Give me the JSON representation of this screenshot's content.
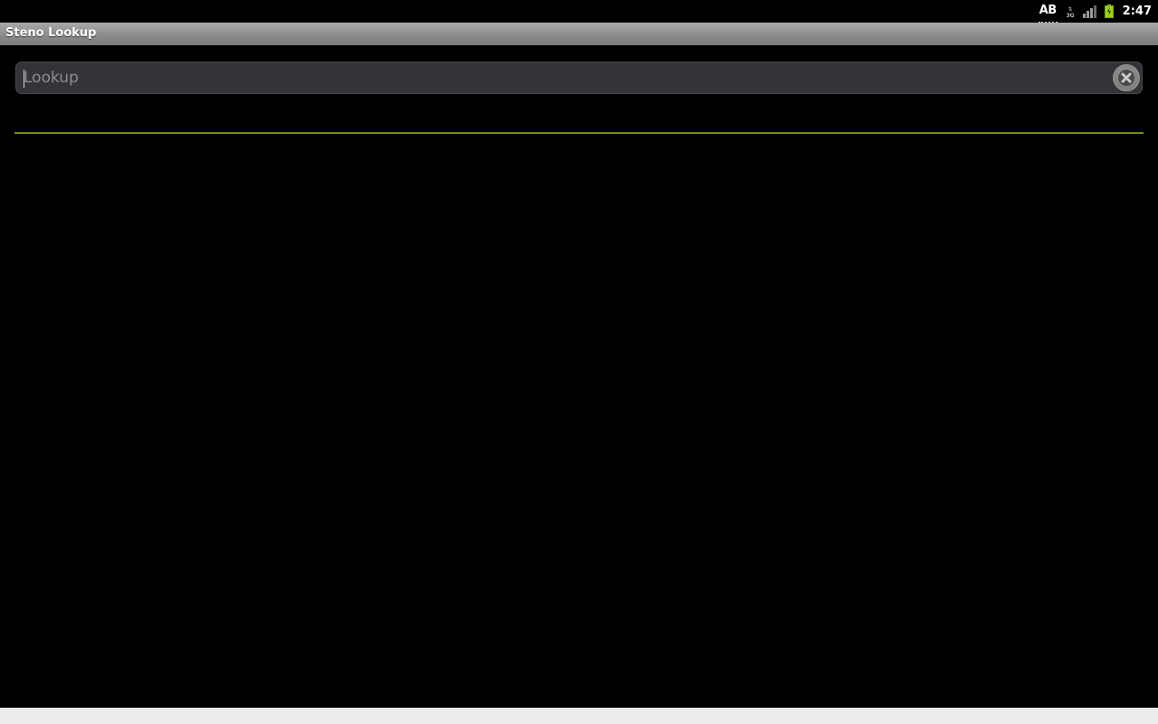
{
  "status_bar": {
    "keyboard_indicator": "AB",
    "time": "2:47",
    "icons": [
      "keyboard-ab-icon",
      "data-3g-icon",
      "signal-icon",
      "battery-icon"
    ],
    "battery_color": "#9bd11b"
  },
  "app": {
    "title": "Steno Lookup"
  },
  "search": {
    "placeholder": "Lookup",
    "value": ""
  },
  "colors": {
    "divider": "#6f8d1d",
    "background": "#000000",
    "title_bar": "#8f8f8f"
  }
}
